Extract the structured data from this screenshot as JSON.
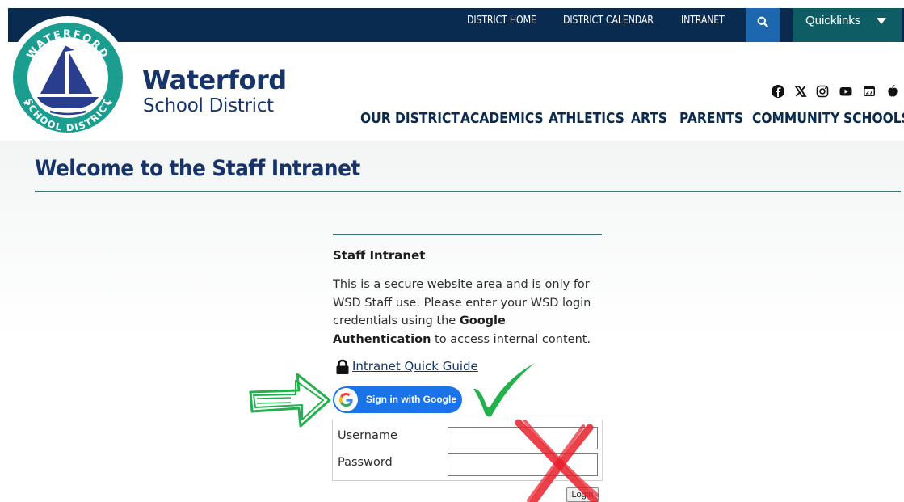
{
  "topbar": {
    "links": [
      "DISTRICT HOME",
      "DISTRICT CALENDAR",
      "INTRANET"
    ],
    "search_icon": "search-icon",
    "quicklinks_label": "Quicklinks"
  },
  "header": {
    "logo_text_top": "WATERFORD",
    "logo_text_bottom": "SCHOOL DISTRICT",
    "brand_line1": "Waterford",
    "brand_line2": "School District",
    "social_icons": [
      "facebook-icon",
      "x-twitter-icon",
      "instagram-icon",
      "youtube-icon",
      "calendar-icon",
      "apple-icon"
    ],
    "nav": [
      "OUR DISTRICT",
      "ACADEMICS",
      "ATHLETICS",
      "ARTS",
      "PARENTS",
      "COMMUNITY",
      "SCHOOLS"
    ]
  },
  "main": {
    "page_title": "Welcome to the Staff Intranet",
    "panel_heading": "Staff Intranet",
    "panel_text_before": "This is a secure website area and is only for WSD Staff use. Please enter your WSD login credentials using the ",
    "panel_text_bold": "Google Authentication",
    "panel_text_after": " to access internal content.",
    "guide_link": "Intranet Quick Guide",
    "google_button": "Sign in with Google",
    "username_label": "Username",
    "password_label": "Password",
    "login_button": "Login"
  },
  "colors": {
    "topbar": "#0a2b50",
    "search": "#1d67ae",
    "quicklinks": "#0e5c64",
    "brand": "#16336a",
    "rule": "#3c7176",
    "google_blue": "#1a73e8",
    "annotation_green": "#22b14c",
    "annotation_red": "#e8202a"
  }
}
